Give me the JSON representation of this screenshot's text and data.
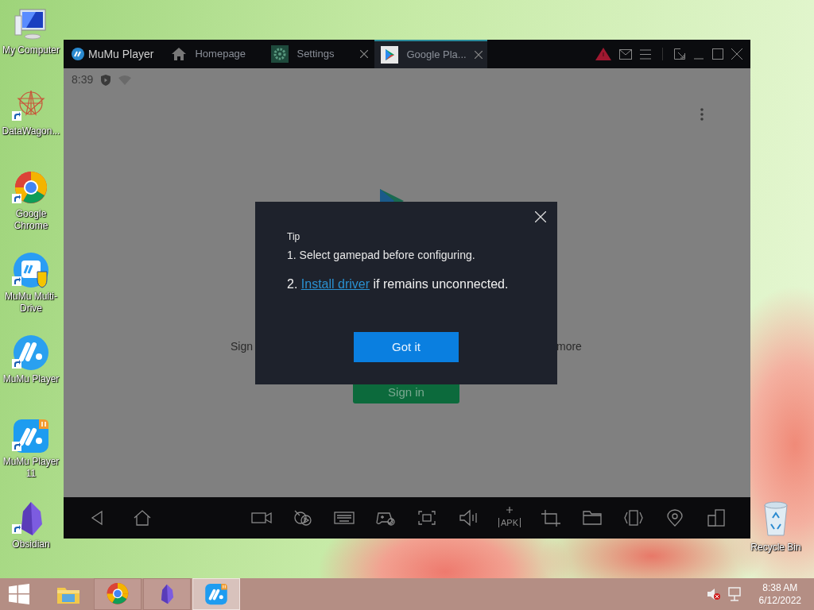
{
  "desktop_icons": [
    {
      "kind": "computer",
      "label": "My Computer"
    },
    {
      "kind": "datawagon",
      "label": "DataWagon..."
    },
    {
      "kind": "chrome",
      "label": "Google Chrome"
    },
    {
      "kind": "multidrive",
      "label": "MuMu Multi-Drive"
    },
    {
      "kind": "mumu",
      "label": "MuMu Player"
    },
    {
      "kind": "mumu11",
      "label": "MuMu Player 11"
    },
    {
      "kind": "obsidian",
      "label": "Obsidian"
    }
  ],
  "recycle_bin": {
    "label": "Recycle Bin"
  },
  "window": {
    "title": "MuMu Player",
    "tabs": [
      {
        "kind": "home",
        "label": "Homepage",
        "selected": false,
        "closable": false
      },
      {
        "kind": "settings",
        "label": "Settings",
        "selected": false,
        "closable": true
      },
      {
        "kind": "play",
        "label": "Google Pla...",
        "selected": true,
        "closable": true
      }
    ]
  },
  "android": {
    "status_time": "8:39",
    "text_left": "Sign",
    "text_right": "more",
    "sign_in_button": "Sign in"
  },
  "toolbar": {
    "apk_label": "APK"
  },
  "dialog": {
    "title": "Tip",
    "line_1": "1. Select gamepad before configuring.",
    "line_2_prefix": "2.",
    "line_2_link": "Install driver",
    "line_2_suffix": "if remains unconnected.",
    "button": "Got it"
  },
  "taskbar": {
    "apps": [
      {
        "kind": "explorer",
        "selected": false
      },
      {
        "kind": "chrome",
        "selected": false
      },
      {
        "kind": "obsidian",
        "selected": false
      },
      {
        "kind": "mumu11",
        "selected": true
      }
    ],
    "time": "8:38 AM",
    "date": "6/12/2022"
  }
}
